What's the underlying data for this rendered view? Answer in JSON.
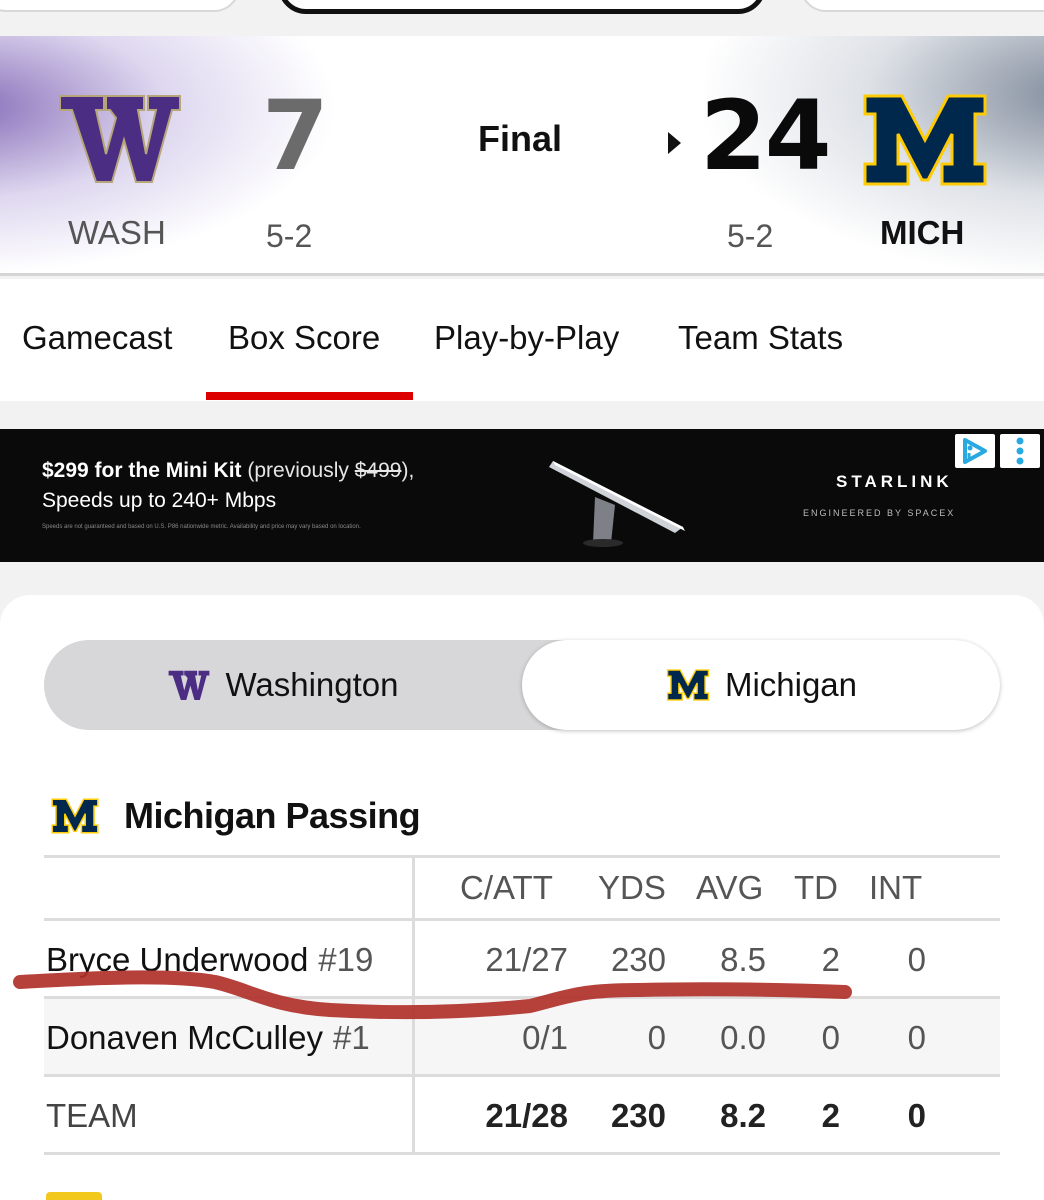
{
  "scoreboard": {
    "status": "Final",
    "away": {
      "abbr": "WASH",
      "score": "7",
      "record": "5-2",
      "logo_letter": "W",
      "color": "#4b2e83"
    },
    "home": {
      "abbr": "MICH",
      "score": "24",
      "record": "5-2",
      "logo_letter": "M",
      "color": "#00274c",
      "accent": "#ffcb05"
    }
  },
  "tabs": [
    {
      "label": "Gamecast",
      "active": false
    },
    {
      "label": "Box Score",
      "active": true
    },
    {
      "label": "Play-by-Play",
      "active": false
    },
    {
      "label": "Team Stats",
      "active": false
    }
  ],
  "ad": {
    "headline_bold": "$299 for the Mini Kit",
    "headline_muted_prefix": " (previously ",
    "headline_strike": "$499",
    "headline_muted_suffix": "),",
    "subline": "Speeds up to 240+ Mbps",
    "fine_print": "Speeds are not guaranteed and based on U.S. P86 nationwide metric. Availability and price may vary based on location.",
    "brand": "STARLINK",
    "brand_sub": "ENGINEERED BY SPACEX",
    "choices_icon": "ad-choices-icon",
    "menu_icon": "kebab-menu-icon"
  },
  "team_toggle": {
    "left": "Washington",
    "right": "Michigan",
    "selected": "Michigan"
  },
  "passing": {
    "title": "Michigan Passing",
    "columns": [
      "C/ATT",
      "YDS",
      "AVG",
      "TD",
      "INT"
    ],
    "rows": [
      {
        "name": "Bryce Underwood",
        "jersey": "#19",
        "stats": [
          "21/27",
          "230",
          "8.5",
          "2",
          "0"
        ]
      },
      {
        "name": "Donaven McCulley",
        "jersey": "#1",
        "stats": [
          "0/1",
          "0",
          "0.0",
          "0",
          "0"
        ]
      }
    ],
    "total": {
      "name": "TEAM",
      "stats": [
        "21/28",
        "230",
        "8.2",
        "2",
        "0"
      ]
    }
  },
  "annotation": {
    "color": "#b0312a"
  }
}
